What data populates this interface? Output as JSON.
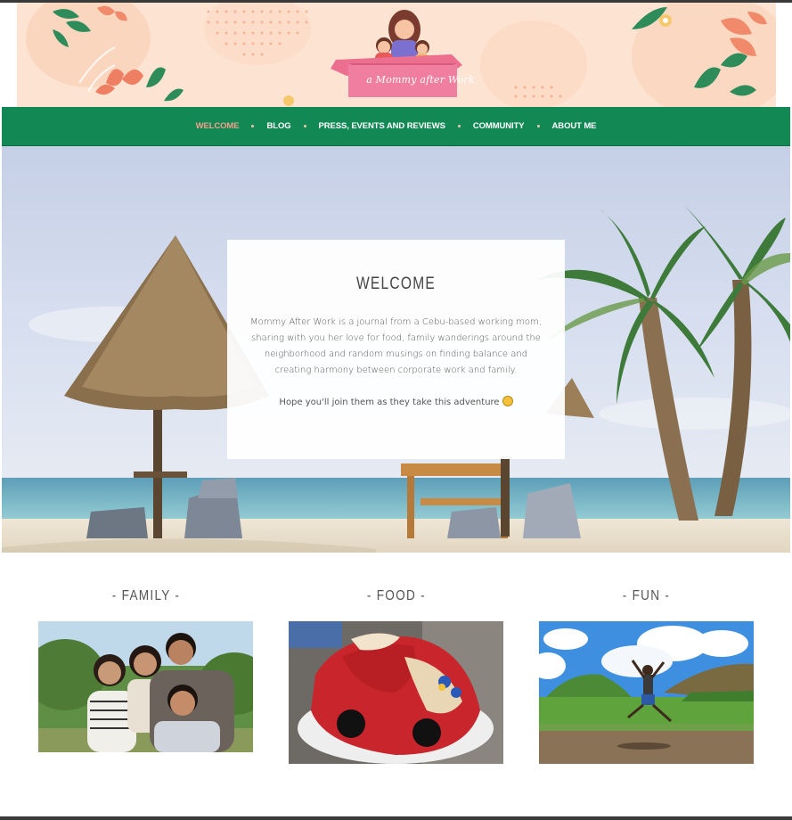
{
  "site": {
    "logo_text": "a Mommy after Work"
  },
  "nav": {
    "items": [
      {
        "label": "WELCOME",
        "active": true
      },
      {
        "label": "BLOG",
        "active": false
      },
      {
        "label": "PRESS, EVENTS AND REVIEWS",
        "active": false
      },
      {
        "label": "COMMUNITY",
        "active": false
      },
      {
        "label": "ABOUT ME",
        "active": false
      }
    ]
  },
  "welcome": {
    "title": "WELCOME",
    "body": "Mommy After Work is a journal from a Cebu-based working mom, sharing with you her love for food, family wanderings around the neighborhood and random musings on finding balance and creating harmony between corporate work and family.",
    "footer": "Hope you'll join them as they take this adventure"
  },
  "categories": [
    {
      "title": "- FAMILY -"
    },
    {
      "title": "- FOOD -"
    },
    {
      "title": "- FUN -"
    }
  ],
  "colors": {
    "nav_bg": "#128855",
    "nav_active": "#f3a08b",
    "banner_bg": "#fde4d2"
  }
}
